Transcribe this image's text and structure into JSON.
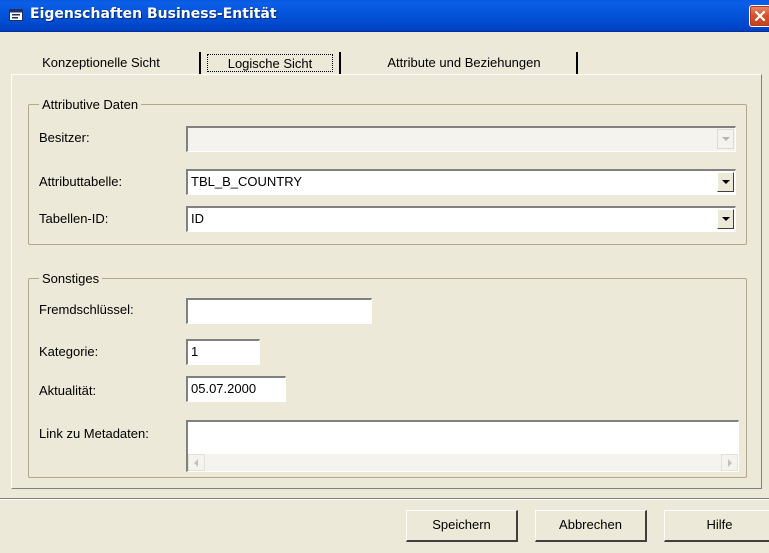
{
  "window": {
    "title": "Eigenschaften Business-Entität"
  },
  "tabs": [
    {
      "label": "Konzeptionelle Sicht"
    },
    {
      "label": "Logische Sicht"
    },
    {
      "label": "Attribute und Beziehungen"
    }
  ],
  "active_tab": "Logische Sicht",
  "attributive": {
    "legend": "Attributive Daten",
    "owner": {
      "label": "Besitzer:",
      "value": "",
      "disabled": true
    },
    "attribute_table": {
      "label": "Attributtabelle:",
      "value": "TBL_B_COUNTRY"
    },
    "table_id": {
      "label": "Tabellen-ID:",
      "value": "ID"
    }
  },
  "misc": {
    "legend": "Sonstiges",
    "foreign_key": {
      "label": "Fremdschlüssel:",
      "value": ""
    },
    "category": {
      "label": "Kategorie:",
      "value": "1"
    },
    "actuality": {
      "label": "Aktualität:",
      "value": "05.07.2000"
    },
    "metadata_link": {
      "label": "Link zu Metadaten:",
      "value": ""
    }
  },
  "buttons": {
    "save": "Speichern",
    "cancel": "Abbrechen",
    "help": "Hilfe"
  },
  "icons": {
    "title": "window-icon",
    "close": "close-icon",
    "dropdown": "chevron-down-icon",
    "scroll_left": "arrow-left-icon",
    "scroll_right": "arrow-right-icon"
  },
  "colors": {
    "titlebar": "#0352d8",
    "dialog_bg": "#ece9d8",
    "close_button": "#d6552f"
  }
}
